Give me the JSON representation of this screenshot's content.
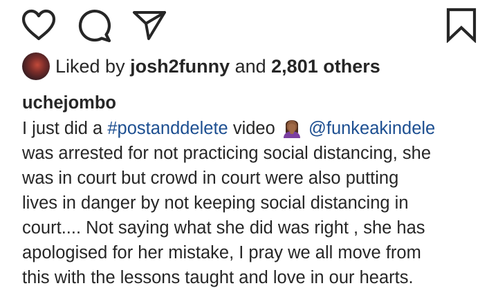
{
  "actions": {
    "like_icon": "heart-outline-icon",
    "comment_icon": "comment-bubble-icon",
    "share_icon": "paper-plane-icon",
    "save_icon": "bookmark-icon"
  },
  "likes": {
    "prefix": "Liked by ",
    "user": "josh2funny",
    "middle": " and ",
    "count": "2,801 others"
  },
  "caption": {
    "username": "uchejombo",
    "line1_a": "I just did a ",
    "hashtag": "#postanddelete",
    "line1_b": " video ",
    "emoji": "facepalm-woman-emoji",
    "mention": "@funkeakindele",
    "line2": "was arrested for not practicing social distancing, she",
    "line3": "was in court but crowd in court were also putting",
    "line4": "lives in danger by not keeping social distancing in",
    "line5": "court.... Not saying what she did was right , she has",
    "line6": "apologised for her mistake, I pray we all move from",
    "line7": "this with the lessons taught and love in our hearts."
  },
  "colors": {
    "text": "#262626",
    "link": "#1d4f91",
    "background": "#ffffff"
  }
}
